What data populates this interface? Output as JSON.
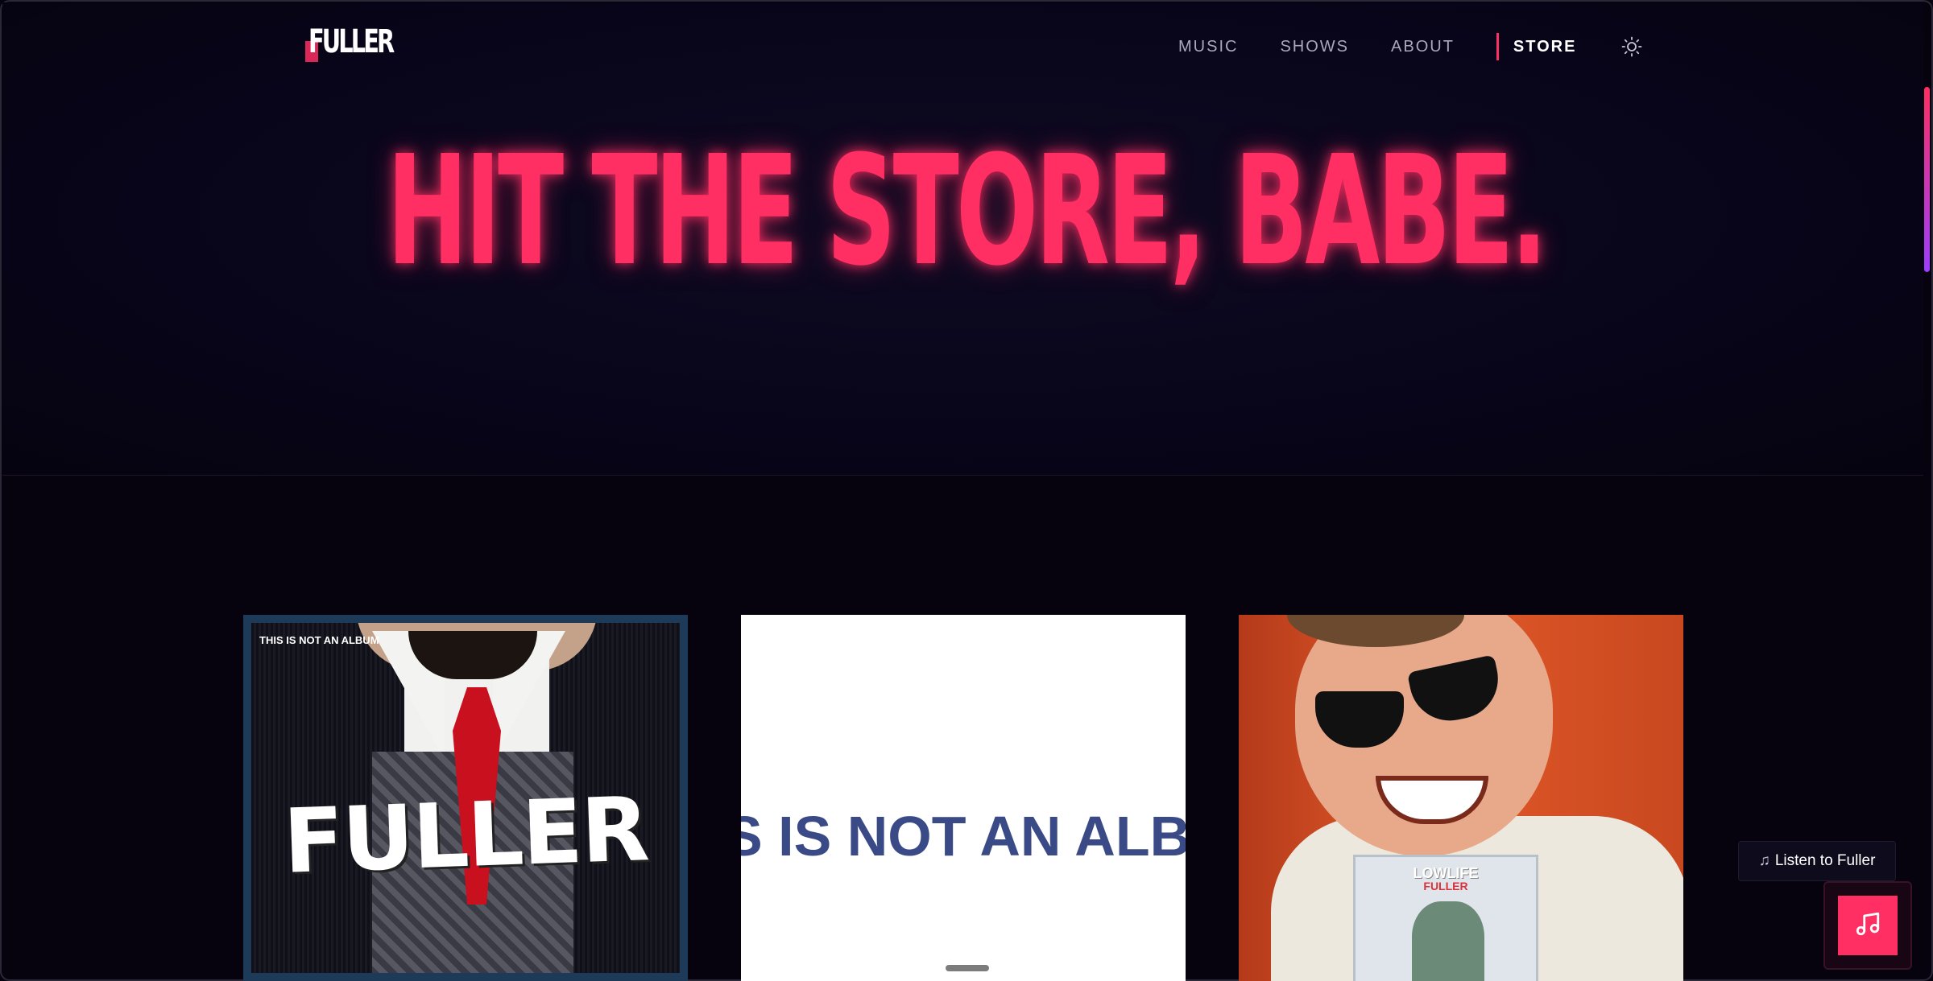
{
  "site": {
    "logo": "FULLER"
  },
  "nav": {
    "items": [
      {
        "label": "MUSIC"
      },
      {
        "label": "SHOWS"
      },
      {
        "label": "ABOUT"
      },
      {
        "label": "STORE",
        "active": true
      }
    ],
    "theme_toggle_icon": "sun-icon"
  },
  "hero": {
    "headline": "HIT THE STORE, BABE."
  },
  "products": [
    {
      "tag": "THIS IS NOT AN ALBUM",
      "cover_text": "FULLER"
    },
    {
      "cover_text": "S IS NOT AN ALB"
    },
    {
      "album_title": "LOWLIFE",
      "album_artist": "FULLER"
    }
  ],
  "player": {
    "listen_label": "Listen to Fuller",
    "icon": "music-note-icon"
  },
  "colors": {
    "accent": "#ff2e63",
    "background": "#06030f",
    "nav_text": "#a9a6bd"
  }
}
